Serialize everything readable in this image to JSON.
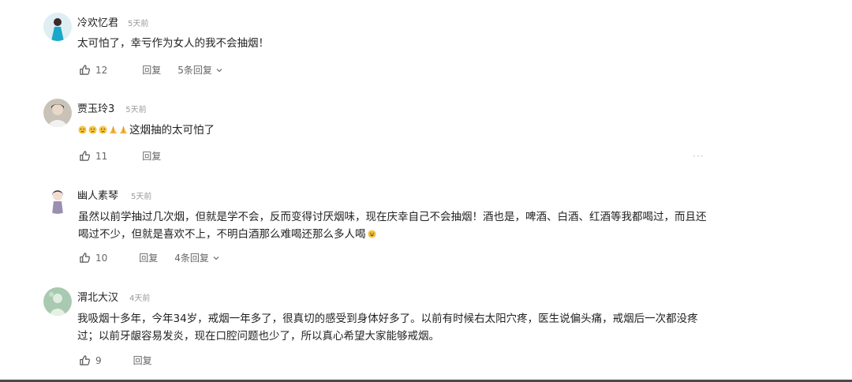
{
  "comments": [
    {
      "username": "冷欢忆君",
      "time": "5天前",
      "text": "太可怕了，幸亏作为女人的我不会抽烟！",
      "likes": "12",
      "reply_label": "回复",
      "replies_label": "5条回复"
    },
    {
      "username": "贾玉玲3",
      "time": "5天前",
      "text": "这烟抽的太可怕了",
      "likes": "11",
      "reply_label": "回复"
    },
    {
      "username": "幽人素琴",
      "time": "5天前",
      "text_line1": "虽然以前学抽过几次烟，但就是学不会，反而变得讨厌烟味，现在庆幸自己不会抽烟！酒也是，啤酒、白酒、红酒等我都喝过，而且还",
      "text_line2": "喝过不少，但就是喜欢不上，不明白酒那么难喝还那么多人喝",
      "likes": "10",
      "reply_label": "回复",
      "replies_label": "4条回复"
    },
    {
      "username": "渭北大汉",
      "time": "4天前",
      "text_line1": "我吸烟十多年，今年34岁，戒烟一年多了，很真切的感受到身体好多了。以前有时候右太阳穴疼，医生说偏头痛，戒烟后一次都没疼",
      "text_line2": "过；以前牙龈容易发炎，现在口腔问题也少了，所以真心希望大家能够戒烟。",
      "likes": "9",
      "reply_label": "回复"
    }
  ],
  "icons": {
    "like": "thumbs-up-icon",
    "expand": "chevron-down-icon",
    "more": "more-icon"
  },
  "colors": {
    "text": "#222222",
    "secondary": "#666666",
    "timestamp": "#999999"
  }
}
